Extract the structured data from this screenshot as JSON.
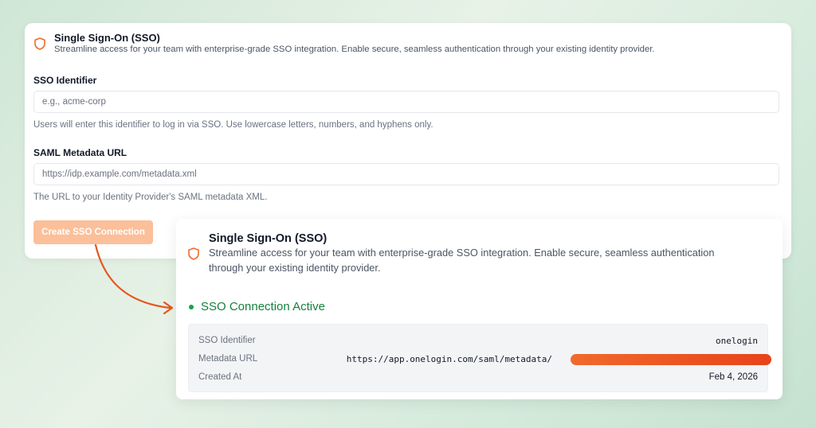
{
  "setup_card": {
    "title": "Single Sign-On (SSO)",
    "subtitle": "Streamline access for your team with enterprise-grade SSO integration. Enable secure, seamless authentication through your existing identity provider.",
    "sso_identifier": {
      "label": "SSO Identifier",
      "placeholder": "e.g., acme-corp",
      "hint": "Users will enter this identifier to log in via SSO. Use lowercase letters, numbers, and hyphens only."
    },
    "saml_url": {
      "label": "SAML Metadata URL",
      "placeholder": "https://idp.example.com/metadata.xml",
      "hint": "The URL to your Identity Provider's SAML metadata XML."
    },
    "create_button_label": "Create SSO Connection"
  },
  "active_card": {
    "title": "Single Sign-On (SSO)",
    "subtitle_line1": "Streamline access for your team with enterprise-grade SSO integration. Enable secure, seamless authentication",
    "subtitle_line2": "through your existing identity provider.",
    "status": "SSO Connection Active",
    "details": [
      {
        "key": "SSO Identifier",
        "value": "onelogin"
      },
      {
        "key": "Metadata URL",
        "value": "https://app.onelogin.com/saml/metadata/"
      },
      {
        "key": "Created At",
        "value": "Feb 4, 2026"
      }
    ]
  },
  "colors": {
    "accent_orange": "#f26a2a",
    "button_disabled": "#fbbf9a",
    "status_green": "#16a34a"
  },
  "icons": [
    "shield-icon",
    "status-dot-icon",
    "curved-arrow-icon"
  ]
}
